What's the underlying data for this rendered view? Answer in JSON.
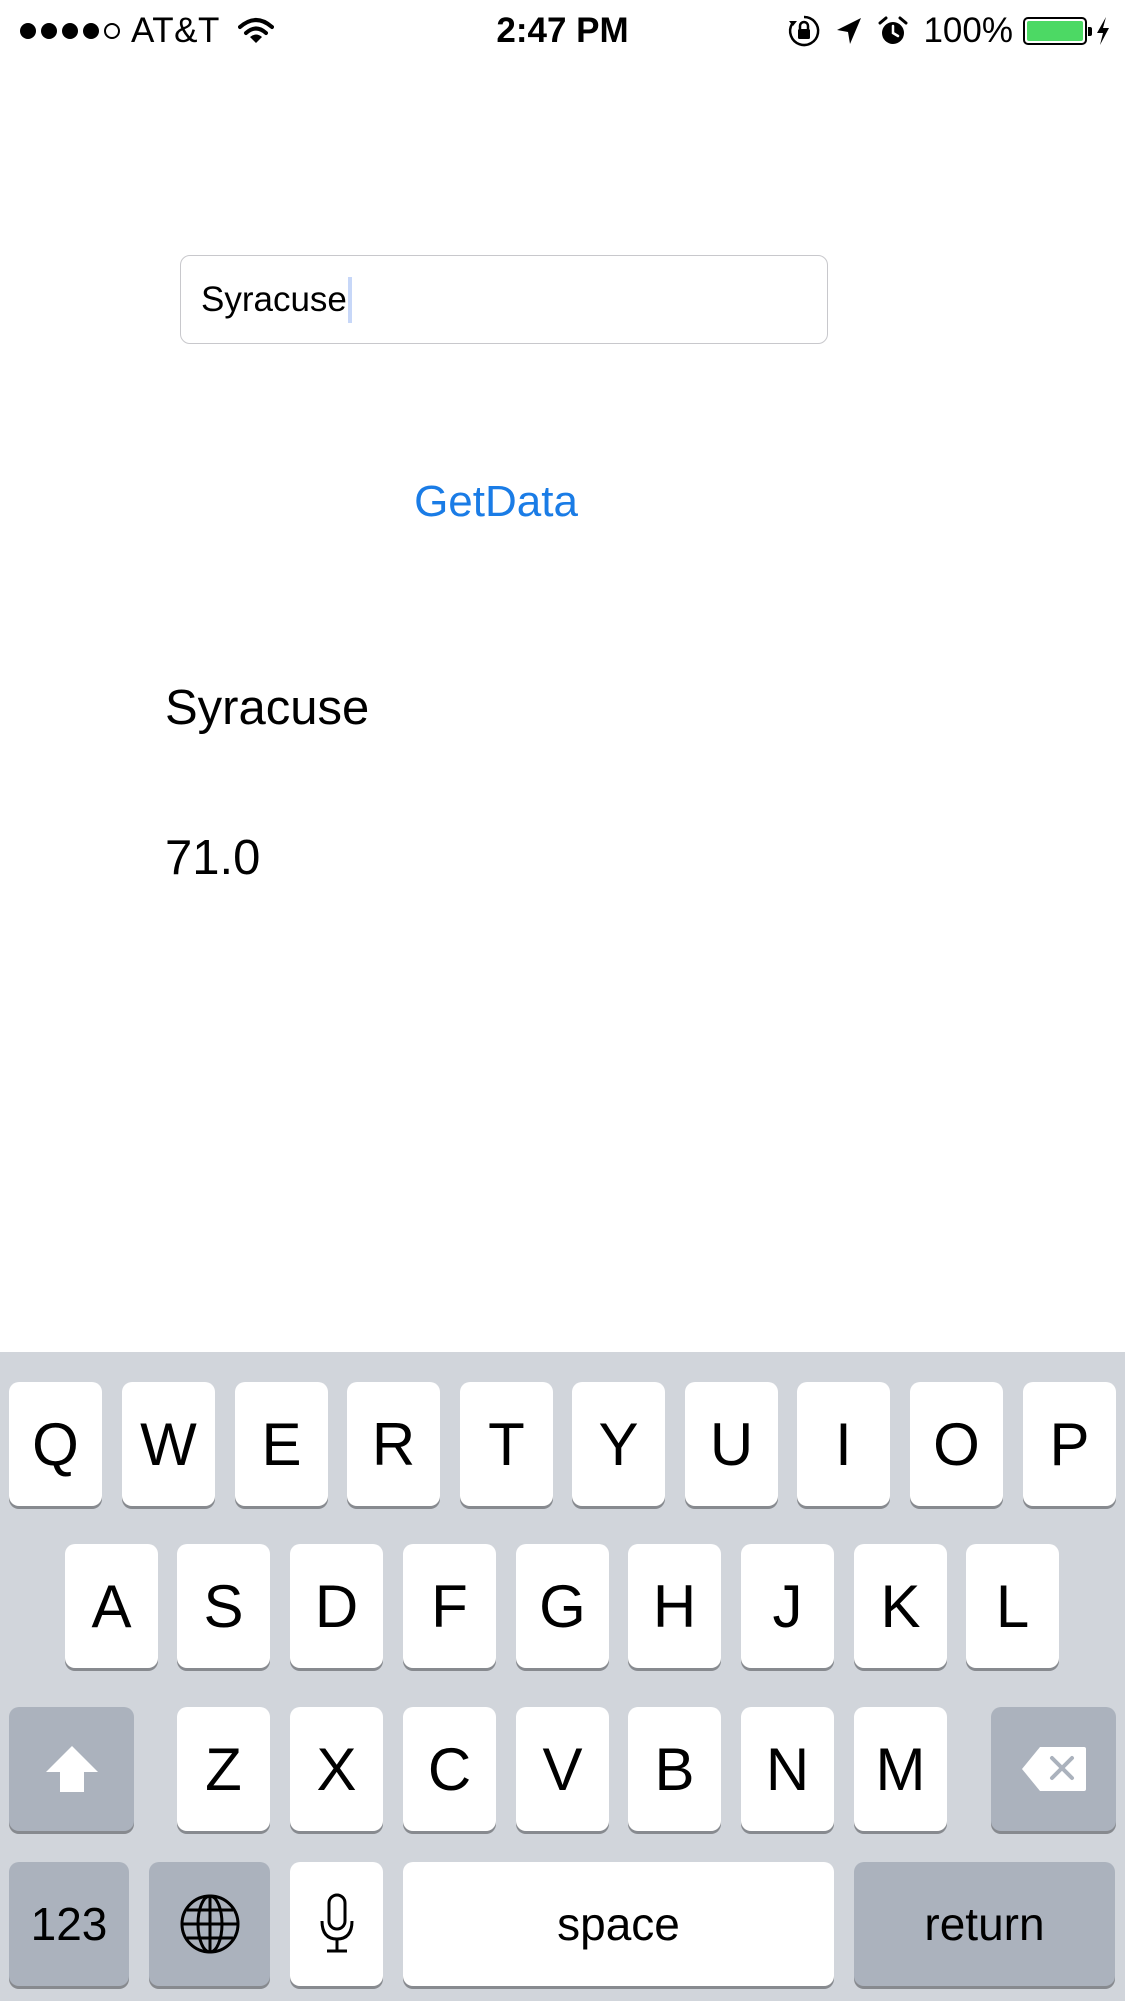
{
  "status_bar": {
    "carrier": "AT&T",
    "time": "2:47 PM",
    "battery_percent": "100%",
    "battery_level": 1.0,
    "signal_bars": 4,
    "icons": [
      "wifi-icon",
      "rotation-lock-icon",
      "location-arrow-icon",
      "alarm-icon",
      "battery-icon",
      "charging-bolt-icon"
    ]
  },
  "form": {
    "city_value": "Syracuse",
    "button_label": "GetData"
  },
  "result": {
    "city": "Syracuse",
    "temperature": "71.0"
  },
  "keyboard": {
    "row1": [
      "Q",
      "W",
      "E",
      "R",
      "T",
      "Y",
      "U",
      "I",
      "O",
      "P"
    ],
    "row2": [
      "A",
      "S",
      "D",
      "F",
      "G",
      "H",
      "J",
      "K",
      "L"
    ],
    "row3": [
      "Z",
      "X",
      "C",
      "V",
      "B",
      "N",
      "M"
    ],
    "numbers_label": "123",
    "space_label": "space",
    "return_label": "return",
    "icons": [
      "shift-icon",
      "delete-icon",
      "globe-icon",
      "microphone-icon"
    ]
  },
  "colors": {
    "accent": "#1a7ce6",
    "battery_green": "#4cd964",
    "keyboard_bg": "#d1d5db",
    "special_key": "#abb2bd"
  }
}
